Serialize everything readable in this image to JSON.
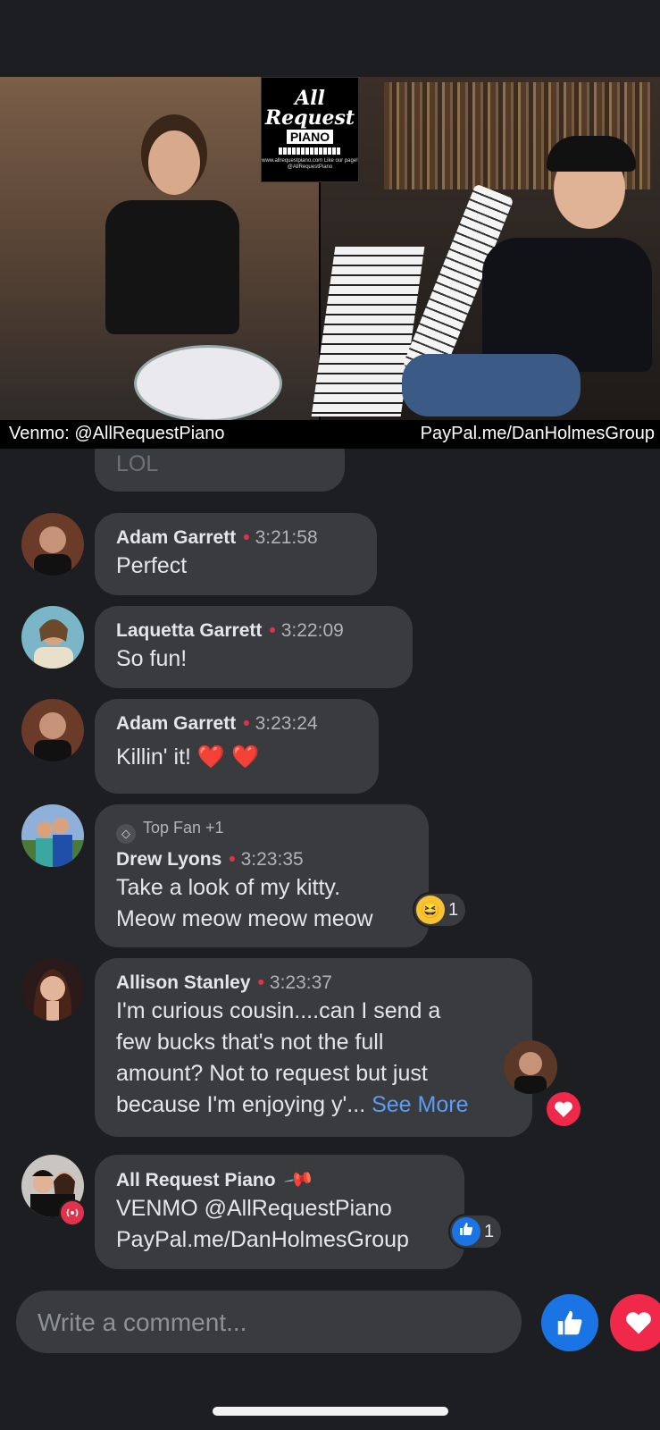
{
  "video": {
    "logo": {
      "line1": "All",
      "line2": "Request",
      "line3": "PIANO",
      "small_text": "www.allrequestpiano.com Like our page! @AllRequestPiano"
    },
    "caption_left": "Venmo: @AllRequestPiano",
    "caption_right": "PayPal.me/DanHolmesGroup"
  },
  "comments": [
    {
      "name": "",
      "time": "",
      "text": "LOL",
      "partial": true
    },
    {
      "name": "Adam Garrett",
      "time": "3:21:58",
      "text": "Perfect"
    },
    {
      "name": "Laquetta Garrett",
      "time": "3:22:09",
      "text": "So fun!"
    },
    {
      "name": "Adam Garrett",
      "time": "3:23:24",
      "text": "Killin' it! ❤️ ❤️"
    },
    {
      "badge": "Top Fan +1",
      "name": "Drew Lyons",
      "time": "3:23:35",
      "lines": [
        "Take a look of my kitty.",
        "Meow meow meow meow"
      ],
      "reaction": {
        "emoji": "laugh",
        "count": "1"
      }
    },
    {
      "name": "Allison Stanley",
      "time": "3:23:37",
      "lines": [
        "I'm curious cousin....can I send a",
        "few bucks that's not the full",
        "amount? Not to request but just",
        "because I'm enjoying y'..."
      ],
      "see_more": "See More",
      "reaction": {
        "emoji": "heart"
      }
    },
    {
      "name": "All Request Piano",
      "pinned_icon": "pin-icon",
      "lines": [
        "VENMO @AllRequestPiano",
        "PayPal.me/DanHolmesGroup"
      ],
      "reaction": {
        "emoji": "like",
        "count": "1"
      }
    }
  ],
  "composer": {
    "placeholder": "Write a comment..."
  },
  "colors": {
    "background": "#1d1e22",
    "bubble": "#3a3b3e",
    "time_dot": "#e0334b",
    "link": "#5b9cf5",
    "like": "#1b74e4",
    "love": "#f02849"
  }
}
